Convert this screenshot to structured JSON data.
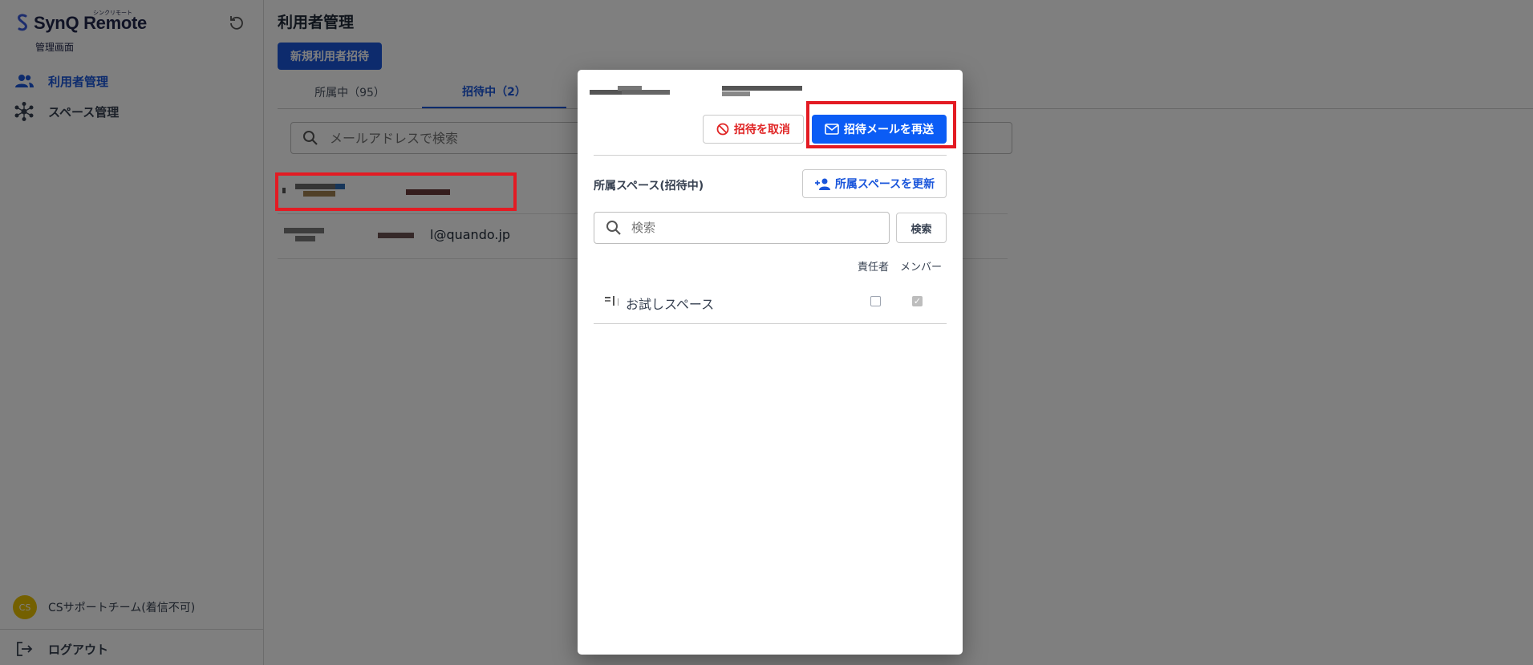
{
  "sidebar": {
    "brand_name": "SynQ Remote",
    "brand_ruby": "シンクリモート",
    "brand_sub": "管理画面",
    "nav": [
      {
        "label": "利用者管理",
        "icon": "users-icon",
        "active": true
      },
      {
        "label": "スペース管理",
        "icon": "spaces-icon",
        "active": false
      }
    ],
    "team": {
      "avatar": "CS",
      "name": "CSサポートチーム(着信不可)"
    },
    "logout_label": "ログアウト"
  },
  "main": {
    "title": "利用者管理",
    "invite_button": "新規利用者招待",
    "tabs": [
      {
        "label": "所属中（95）",
        "active": false
      },
      {
        "label": "招待中（2）",
        "active": true
      }
    ],
    "search_placeholder": "メールアドレスで検索",
    "rows": [
      {
        "email": ""
      },
      {
        "email": "l@quando.jp"
      }
    ]
  },
  "modal": {
    "cancel_button": "招待を取消",
    "resend_button": "招待メールを再送",
    "section_title": "所属スペース(招待中)",
    "update_button": "所属スペースを更新",
    "search_placeholder": "検索",
    "search_button": "検索",
    "col_owner": "責任者",
    "col_member": "メンバー",
    "spaces": [
      {
        "name": "お試しスペース",
        "owner": false,
        "member": true
      }
    ]
  },
  "colors": {
    "primary": "#1a56db",
    "resend": "#0b5cf5",
    "danger": "#e02424",
    "highlight": "#e31b23",
    "avatar": "#e8c000"
  }
}
